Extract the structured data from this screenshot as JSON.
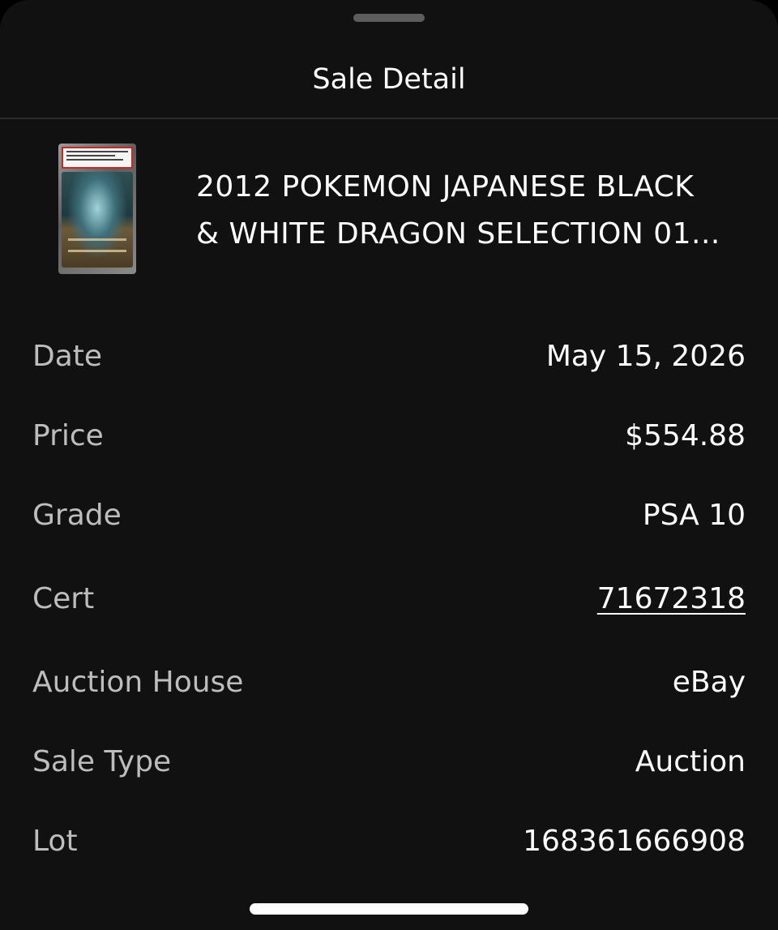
{
  "header": {
    "title": "Sale Detail"
  },
  "item": {
    "title_line1": "2012 POKEMON JAPANESE BLACK",
    "title_line2": "& WHITE DRAGON SELECTION 01...",
    "image": "graded-card-thumbnail"
  },
  "details": [
    {
      "label": "Date",
      "value": "May 15, 2026",
      "link": false
    },
    {
      "label": "Price",
      "value": "$554.88",
      "link": false
    },
    {
      "label": "Grade",
      "value": "PSA 10",
      "link": false
    },
    {
      "label": "Cert",
      "value": "71672318",
      "link": true
    },
    {
      "label": "Auction House",
      "value": "eBay",
      "link": false
    },
    {
      "label": "Sale Type",
      "value": "Auction",
      "link": false
    },
    {
      "label": "Lot",
      "value": "168361666908",
      "link": false
    }
  ],
  "colors": {
    "background": "#111111",
    "label": "#bdbdbd",
    "value": "#ffffff",
    "divider": "#2a2a2a"
  }
}
